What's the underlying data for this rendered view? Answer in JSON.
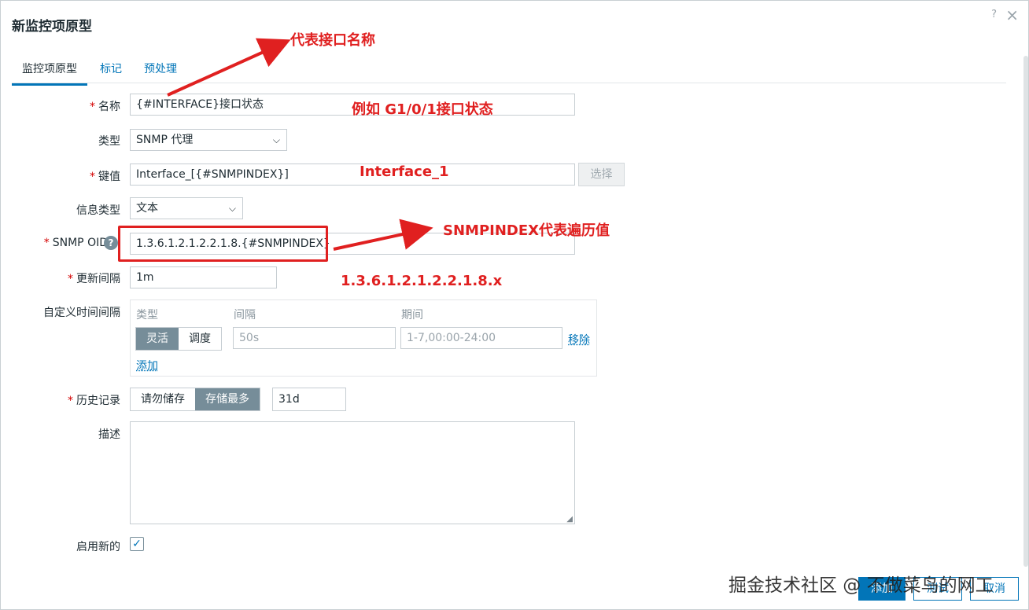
{
  "dialog": {
    "title": "新监控项原型",
    "help": "?",
    "close": "×"
  },
  "tabs": [
    {
      "label": "监控项原型"
    },
    {
      "label": "标记"
    },
    {
      "label": "预处理"
    }
  ],
  "form": {
    "name": {
      "label": "名称",
      "value": "{#INTERFACE}接口状态"
    },
    "type": {
      "label": "类型",
      "value": "SNMP 代理"
    },
    "key": {
      "label": "键值",
      "value": "Interface_[{#SNMPINDEX}]",
      "select_button": "选择"
    },
    "info_type": {
      "label": "信息类型",
      "value": "文本"
    },
    "snmp_oid": {
      "label": "SNMP OID",
      "value": "1.3.6.1.2.1.2.2.1.8.{#SNMPINDEX}"
    },
    "update_interval": {
      "label": "更新间隔",
      "value": "1m"
    },
    "custom_intervals": {
      "label": "自定义时间间隔",
      "col_type": "类型",
      "col_interval": "间隔",
      "col_period": "期间",
      "mode_flexible": "灵活",
      "mode_scheduling": "调度",
      "interval_placeholder": "50s",
      "period_placeholder": "1-7,00:00-24:00",
      "remove": "移除",
      "add": "添加"
    },
    "history": {
      "label": "历史记录",
      "opt_no": "请勿储存",
      "opt_store": "存储最多",
      "value": "31d"
    },
    "description": {
      "label": "描述"
    },
    "enabled": {
      "label": "启用新的"
    }
  },
  "footer": {
    "add": "添加",
    "test": "测试",
    "cancel": "取消"
  },
  "annotations": {
    "a1": "代表接口名称",
    "a2": "例如   G1/0/1接口状态",
    "a3": "Interface_1",
    "a4": "SNMPINDEX代表遍历值",
    "a5": "1.3.6.1.2.1.2.2.1.8.x"
  },
  "watermark": "掘金技术社区 @ 不做菜鸟的网工",
  "colors": {
    "accent": "#0275b8",
    "annotation": "#e02020",
    "required": "#d40000"
  }
}
